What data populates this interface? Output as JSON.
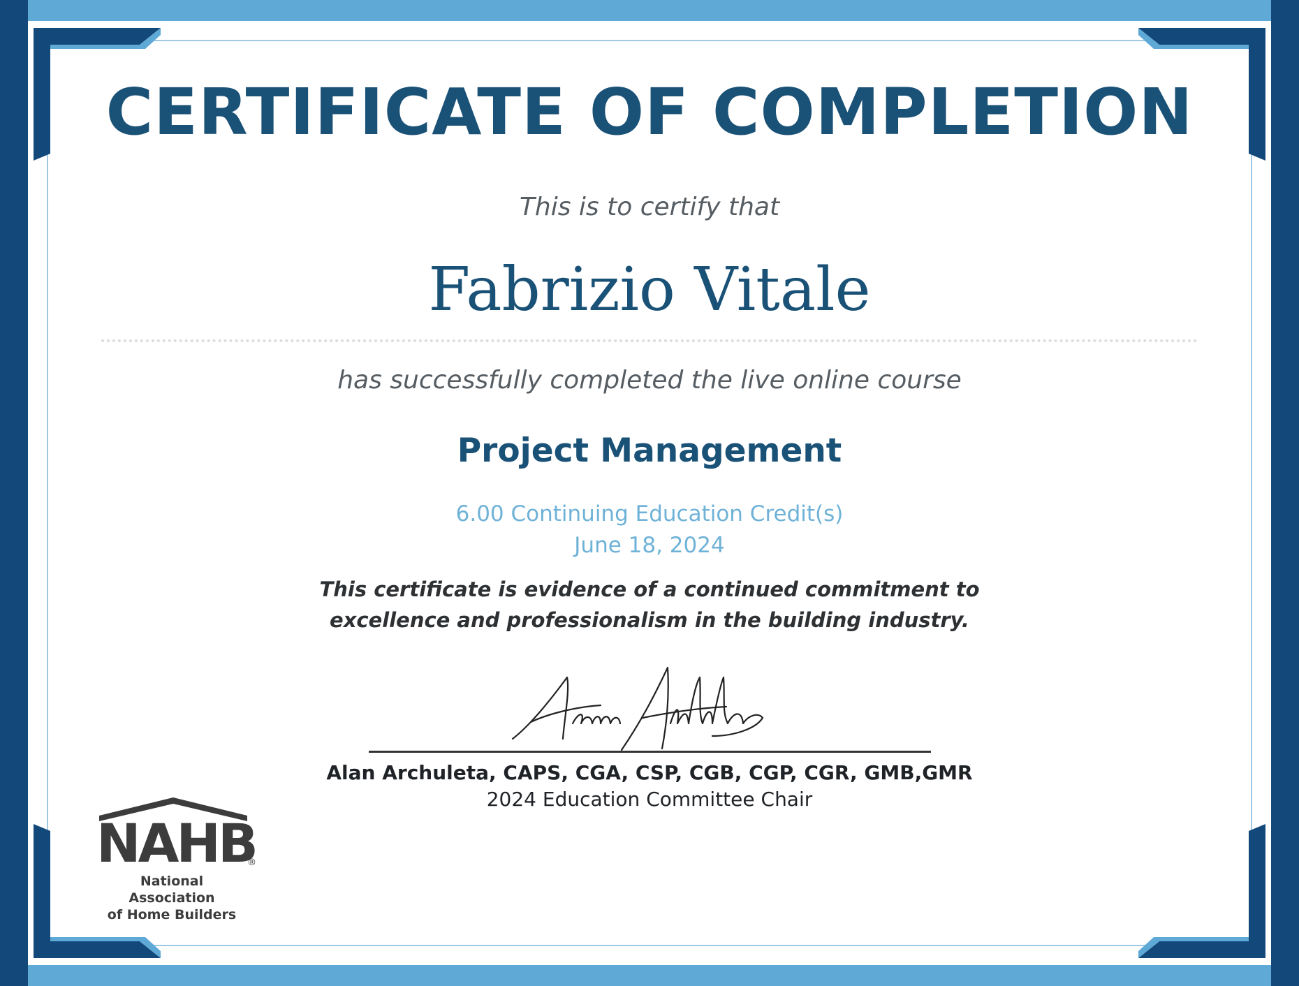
{
  "certificate": {
    "title": "CERTIFICATE OF COMPLETION",
    "certify_line": "This is to certify that",
    "recipient": "Fabrizio Vitale",
    "completed_line": "has successfully completed the live online course",
    "course": "Project Management",
    "credits": "6.00 Continuing Education Credit(s)",
    "date": "June 18, 2024",
    "statement_line1": "This certificate is evidence of a continued commitment to",
    "statement_line2": "excellence and professionalism in the building industry."
  },
  "signatory": {
    "signature_text": "Alan Archuleta",
    "name": "Alan Archuleta, CAPS, CGA, CSP, CGB, CGP, CGR, GMB,GMR",
    "role": "2024 Education Committee Chair"
  },
  "logo": {
    "mark": "NAHB",
    "registered": "®",
    "line1": "National Association",
    "line2": "of Home Builders"
  },
  "colors": {
    "frame_dark": "#12497a",
    "frame_light": "#5fa9d6",
    "title_blue": "#1a5176",
    "accent_light_blue": "#6fb2d7",
    "logo_gray": "#3c3c3c"
  }
}
